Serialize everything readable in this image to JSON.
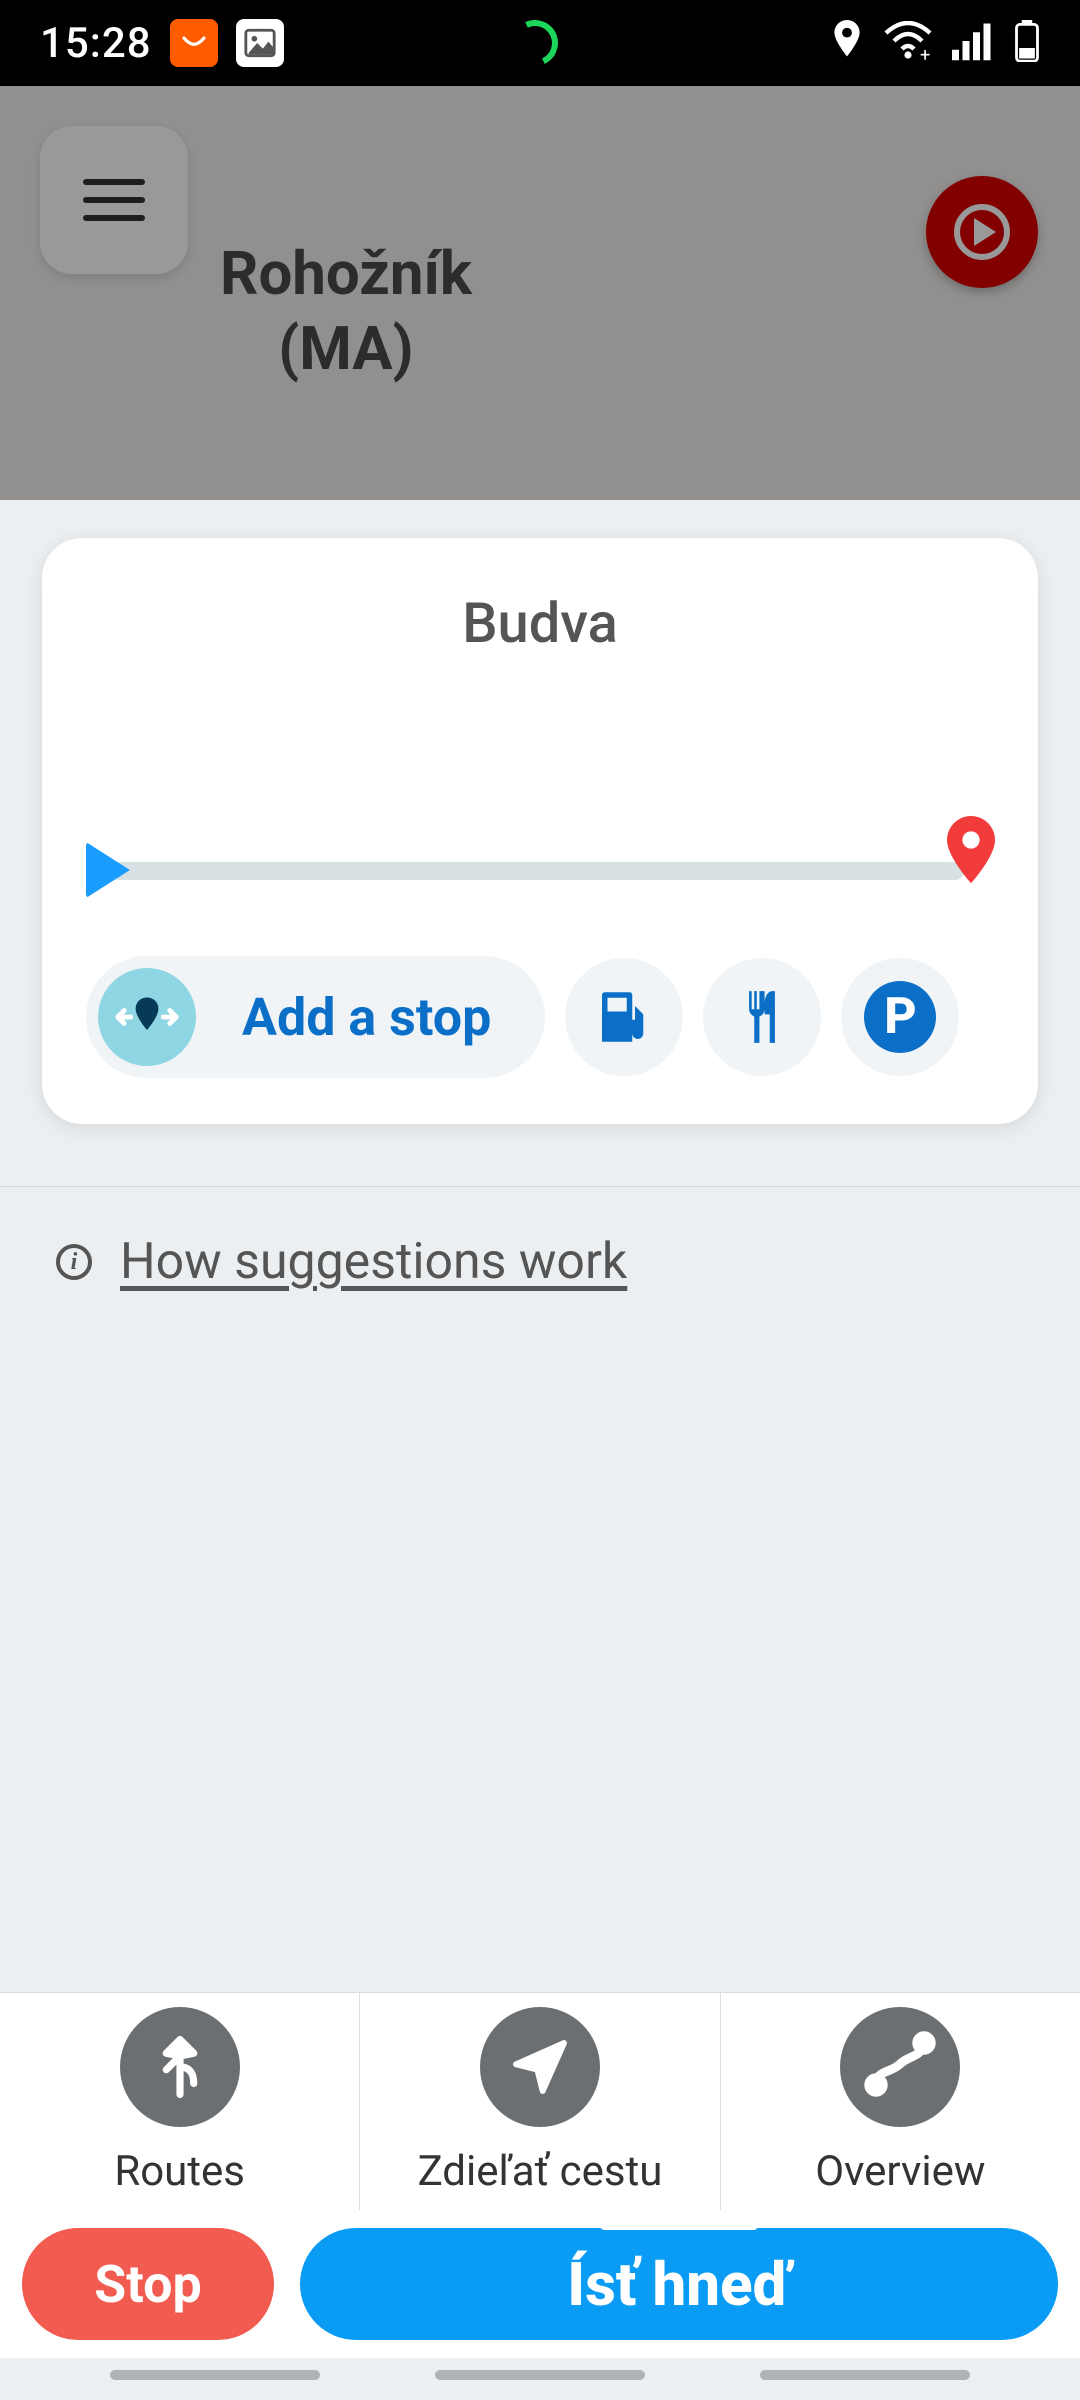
{
  "status": {
    "time": "15:28"
  },
  "map": {
    "current_location": "Rohožník\n(MA)"
  },
  "card": {
    "destination": "Budva",
    "add_stop": "Add a stop"
  },
  "info": {
    "how_link": "How suggestions work"
  },
  "tabs": {
    "routes": "Routes",
    "share": "Zdieľať cestu",
    "overview": "Overview"
  },
  "actions": {
    "stop": "Stop",
    "go": "Ísť hneď"
  }
}
